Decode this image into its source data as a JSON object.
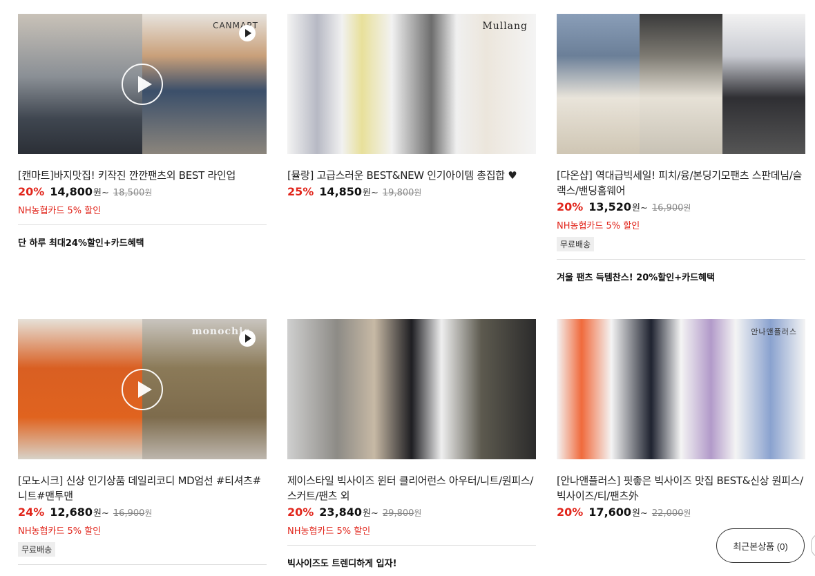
{
  "products": [
    {
      "brand_mark": "CANMART",
      "title": "[캔마트]바지맛집! 키작진 깐깐팬츠외 BEST 라인업",
      "discount": "20%",
      "price": "14,800",
      "unit": "원~",
      "original_price": "18,500",
      "original_unit": "원",
      "card_note": "NH농협카드 5% 할인",
      "badge": "",
      "promo": "단 하루 최대24%할인+카드혜택",
      "has_video": true
    },
    {
      "brand_mark": "Mullang",
      "title": "[뮬랑] 고급스러운 BEST&NEW 인기아이템 총집합 ♥",
      "discount": "25%",
      "price": "14,850",
      "unit": "원~",
      "original_price": "19,800",
      "original_unit": "원",
      "card_note": "",
      "badge": "",
      "promo": "",
      "has_video": false
    },
    {
      "brand_mark": "",
      "title": "[다온샵] 역대급빅세일! 피치/융/본딩기모팬츠 스판데님/슬랙스/밴딩홈웨어",
      "discount": "20%",
      "price": "13,520",
      "unit": "원~",
      "original_price": "16,900",
      "original_unit": "원",
      "card_note": "NH농협카드 5% 할인",
      "badge": "무료배송",
      "promo": "겨울 팬츠 득템찬스! 20%할인+카드혜택",
      "has_video": false
    },
    {
      "brand_mark": "monochic",
      "title": "[모노시크] 신상 인기상품 데일리코디 MD엄선 #티셔츠#니트#맨투맨",
      "discount": "24%",
      "price": "12,680",
      "unit": "원~",
      "original_price": "16,900",
      "original_unit": "원",
      "card_note": "NH농협카드 5% 할인",
      "badge": "무료배송",
      "promo": "",
      "has_video": true
    },
    {
      "brand_mark": "",
      "title": "제이스타일 빅사이즈 윈터 클리어런스 아우터/니트/원피스/스커트/팬츠 외",
      "discount": "20%",
      "price": "23,840",
      "unit": "원~",
      "original_price": "29,800",
      "original_unit": "원",
      "card_note": "NH농협카드 5% 할인",
      "badge": "",
      "promo": "빅사이즈도 트렌디하게 입자!",
      "has_video": false
    },
    {
      "brand_mark": "안나앤플러스",
      "title": "[안나앤플러스] 핏좋은 빅사이즈 맛집 BEST&신상 원피스/빅사이즈/티/팬츠外",
      "discount": "20%",
      "price": "17,600",
      "unit": "원~",
      "original_price": "22,000",
      "original_unit": "원",
      "card_note": "",
      "badge": "",
      "promo": "",
      "has_video": false
    }
  ],
  "recent_button": {
    "label": "최근본상품 (0)"
  },
  "colors": {
    "discount": "#e1251b",
    "price": "#111111",
    "original": "#888888"
  }
}
